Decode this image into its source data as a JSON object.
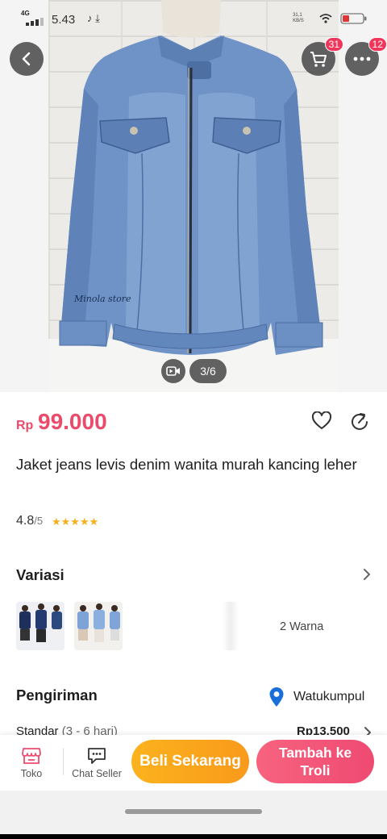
{
  "status_bar": {
    "network": "4G",
    "time": "5.43",
    "icons": "♪ ⤓",
    "speed": "31,1 KB/S",
    "battery_icon": "battery-icon"
  },
  "header": {
    "back_icon": "chevron-left-icon",
    "cart_badge": "31",
    "more_badge": "12"
  },
  "gallery": {
    "watermark": "Minola store",
    "counter": "3/6",
    "video_icon": "video-icon"
  },
  "product": {
    "currency": "Rp",
    "price": "99.000",
    "title": "Jaket jeans levis denim wanita murah kancing leher",
    "rating": "4.8",
    "rating_of": "/5",
    "rating_value": 4.8,
    "stars": "★★★★★"
  },
  "variants": {
    "heading": "Variasi",
    "count_label": "2 Warna"
  },
  "shipping": {
    "heading": "Pengiriman",
    "location": "Watukumpul",
    "service": "Standar",
    "duration": "(3 - 6 hari)",
    "price": "Rp13.500"
  },
  "actions": {
    "store_label": "Toko",
    "chat_label": "Chat Seller",
    "buy_label": "Beli Sekarang",
    "cart_label": "Tambah ke Troli"
  },
  "colors": {
    "price": "#ec4a6a",
    "buy_button": "#fbb21d",
    "cart_button": "#ef4a72",
    "badge": "#f0365a",
    "pin": "#1a6ed8"
  }
}
